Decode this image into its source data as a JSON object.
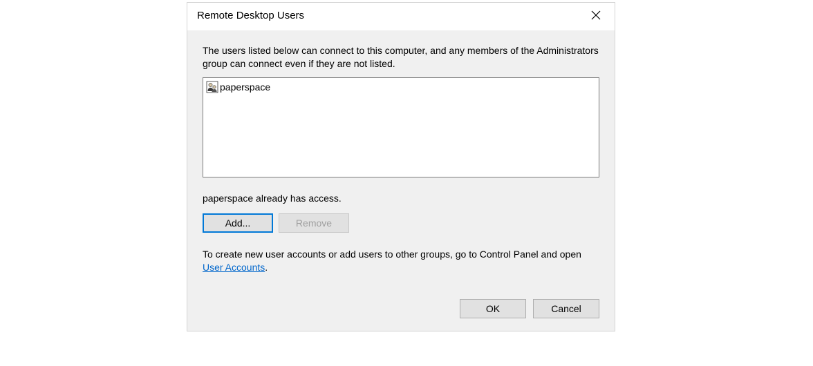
{
  "dialog": {
    "title": "Remote Desktop Users",
    "description": "The users listed below can connect to this computer, and any members of the Administrators group can connect even if they are not listed.",
    "users": [
      {
        "name": "paperspace"
      }
    ],
    "status": "paperspace already has access.",
    "buttons": {
      "add": "Add...",
      "remove": "Remove"
    },
    "hint_prefix": "To create new user accounts or add users to other groups, go to Control Panel and open ",
    "hint_link": "User Accounts",
    "hint_suffix": ".",
    "footer": {
      "ok": "OK",
      "cancel": "Cancel"
    }
  }
}
